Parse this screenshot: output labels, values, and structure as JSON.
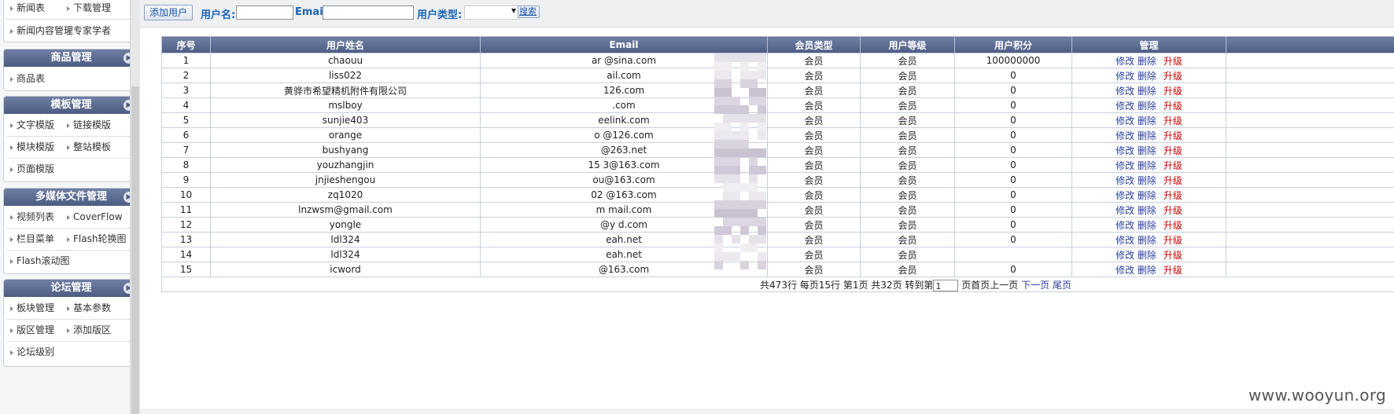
{
  "sidebar": {
    "top_items": [
      "新闻表",
      "下载管理",
      "新闻内容管理",
      "专家学者"
    ],
    "sections": [
      {
        "title": "商品管理",
        "items": [
          "商品表"
        ]
      },
      {
        "title": "模板管理",
        "items": [
          "文字模版",
          "链接模版",
          "模块模版",
          "整站模板",
          "页面模版"
        ]
      },
      {
        "title": "多媒体文件管理",
        "items": [
          "视频列表",
          "CoverFlow",
          "栏目菜单",
          "Flash轮换图",
          "Flash滚动图"
        ]
      },
      {
        "title": "论坛管理",
        "items": [
          "板块管理",
          "基本参数",
          "版区管理",
          "添加版区",
          "论坛级别"
        ]
      }
    ]
  },
  "toolbar": {
    "add_user": "添加用户",
    "username_label": "用户名:",
    "email_label": "Email:",
    "usertype_label": "用户类型:",
    "search": "搜索",
    "username_value": "",
    "email_value": "",
    "usertype_value": ""
  },
  "table": {
    "headers": [
      "序号",
      "用户姓名",
      "Email",
      "会员类型",
      "用户等级",
      "用户积分",
      "管理"
    ],
    "action_edit": "修改",
    "action_delete": "删除",
    "action_upgrade": "升级",
    "rows": [
      {
        "id": "1",
        "name": "chaouu",
        "email": "ar   @sina.com",
        "type": "会员",
        "level": "会员",
        "points": "100000000"
      },
      {
        "id": "2",
        "name": "liss022",
        "email": "ail.com",
        "type": "会员",
        "level": "会员",
        "points": "0"
      },
      {
        "id": "3",
        "name": "黄骅市希望精机附件有限公司",
        "email": "126.com",
        "type": "会员",
        "level": "会员",
        "points": "0"
      },
      {
        "id": "4",
        "name": "mslboy",
        "email": ".com",
        "type": "会员",
        "level": "会员",
        "points": "0"
      },
      {
        "id": "5",
        "name": "sunjie403",
        "email": "eelink.com",
        "type": "会员",
        "level": "会员",
        "points": "0"
      },
      {
        "id": "6",
        "name": "orange",
        "email": "o   @126.com",
        "type": "会员",
        "level": "会员",
        "points": "0"
      },
      {
        "id": "7",
        "name": "bushyang",
        "email": "@263.net",
        "type": "会员",
        "level": "会员",
        "points": "0"
      },
      {
        "id": "8",
        "name": "youzhangjin",
        "email": "15   3@163.com",
        "type": "会员",
        "level": "会员",
        "points": "0"
      },
      {
        "id": "9",
        "name": "jnjieshengou",
        "email": "ou@163.com",
        "type": "会员",
        "level": "会员",
        "points": "0"
      },
      {
        "id": "10",
        "name": "zq1020",
        "email": "02   @163.com",
        "type": "会员",
        "level": "会员",
        "points": "0"
      },
      {
        "id": "11",
        "name": "lnzwsm@gmail.com",
        "email": "m   mail.com",
        "type": "会员",
        "level": "会员",
        "points": "0"
      },
      {
        "id": "12",
        "name": "yongle",
        "email": "@y   d.com",
        "type": "会员",
        "level": "会员",
        "points": "0"
      },
      {
        "id": "13",
        "name": "ldl324",
        "email": "eah.net",
        "type": "会员",
        "level": "会员",
        "points": "0"
      },
      {
        "id": "14",
        "name": "ldl324",
        "email": "eah.net",
        "type": "会员",
        "level": "会员",
        "points": ""
      },
      {
        "id": "15",
        "name": "icword",
        "email": "@163.com",
        "type": "会员",
        "level": "会员",
        "points": "0"
      }
    ]
  },
  "pager": {
    "summary": "共473行 每页15行  第1页 共32页  转到第",
    "page_value": "1",
    "unit": "页",
    "first": "首页",
    "prev": "上一页",
    "next": "下一页",
    "last": "尾页"
  },
  "watermark": "www.wooyun.org"
}
